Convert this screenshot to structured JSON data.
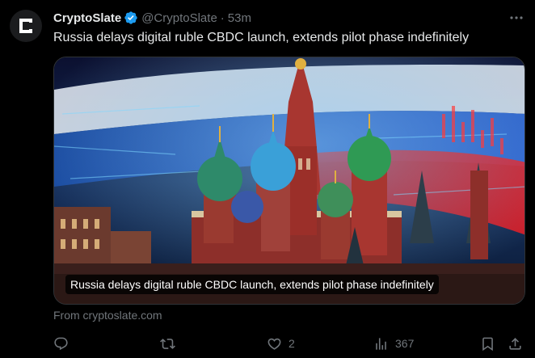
{
  "post": {
    "display_name": "CryptoSlate",
    "handle": "@CryptoSlate",
    "separator": "·",
    "time": "53m",
    "text": "Russia delays digital ruble CBDC launch, extends pilot phase indefinitely",
    "media_caption": "Russia delays digital ruble CBDC launch, extends pilot phase indefinitely",
    "link_source": "From cryptoslate.com"
  },
  "actions": {
    "reply_count": "",
    "repost_count": "",
    "like_count": "2",
    "views_count": "367"
  },
  "icons": {
    "avatar": "cryptoslate-logo-icon",
    "verified": "verified-badge-icon",
    "more": "more-icon",
    "reply": "reply-icon",
    "repost": "repost-icon",
    "like": "heart-icon",
    "views": "views-icon",
    "bookmark": "bookmark-icon",
    "share": "share-icon"
  },
  "colors": {
    "background": "#000000",
    "text_primary": "#e7e9ea",
    "text_secondary": "#71767b",
    "verified": "#1d9bf0"
  }
}
